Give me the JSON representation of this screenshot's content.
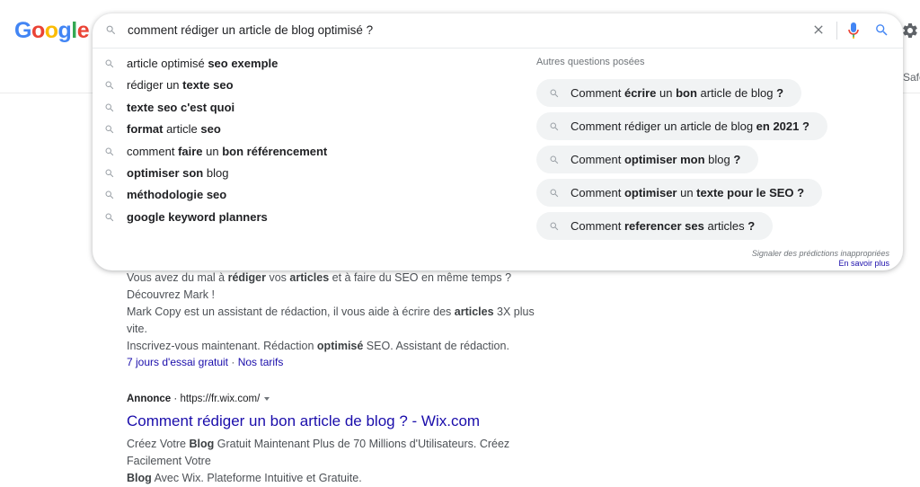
{
  "logo": {
    "letters": [
      {
        "char": "G",
        "color": "#4285F4"
      },
      {
        "char": "o",
        "color": "#EA4335"
      },
      {
        "char": "o",
        "color": "#FBBC05"
      },
      {
        "char": "g",
        "color": "#4285F4"
      },
      {
        "char": "l",
        "color": "#34A853"
      },
      {
        "char": "e",
        "color": "#EA4335"
      }
    ]
  },
  "search": {
    "query": "comment rédiger un article de blog optimisé ?",
    "icons": {
      "search": "search-icon",
      "clear": "close-icon",
      "voice": "mic-icon",
      "submit": "search-icon"
    }
  },
  "suggestions": [
    {
      "parts": [
        {
          "t": "article optimisé ",
          "b": false
        },
        {
          "t": "seo exemple",
          "b": true
        }
      ]
    },
    {
      "parts": [
        {
          "t": "rédiger un ",
          "b": false
        },
        {
          "t": "texte seo",
          "b": true
        }
      ]
    },
    {
      "parts": [
        {
          "t": "texte seo c'est quoi",
          "b": true
        }
      ]
    },
    {
      "parts": [
        {
          "t": "format",
          "b": true
        },
        {
          "t": " article ",
          "b": false
        },
        {
          "t": "seo",
          "b": true
        }
      ]
    },
    {
      "parts": [
        {
          "t": "comment ",
          "b": false
        },
        {
          "t": "faire",
          "b": true
        },
        {
          "t": " un ",
          "b": false
        },
        {
          "t": "bon référencement",
          "b": true
        }
      ]
    },
    {
      "parts": [
        {
          "t": "optimiser son",
          "b": true
        },
        {
          "t": " blog",
          "b": false
        }
      ]
    },
    {
      "parts": [
        {
          "t": "méthodologie seo",
          "b": true
        }
      ]
    },
    {
      "parts": [
        {
          "t": "google keyword planners",
          "b": true
        }
      ]
    }
  ],
  "related_questions": {
    "title": "Autres questions posées",
    "items": [
      {
        "parts": [
          {
            "t": "Comment ",
            "b": false
          },
          {
            "t": "écrire",
            "b": true
          },
          {
            "t": " un ",
            "b": false
          },
          {
            "t": "bon",
            "b": true
          },
          {
            "t": " article de blog ",
            "b": false
          },
          {
            "t": "?",
            "b": true
          }
        ]
      },
      {
        "parts": [
          {
            "t": "Comment rédiger un article de blog ",
            "b": false
          },
          {
            "t": "en 2021 ?",
            "b": true
          }
        ]
      },
      {
        "parts": [
          {
            "t": "Comment ",
            "b": false
          },
          {
            "t": "optimiser mon",
            "b": true
          },
          {
            "t": " blog ",
            "b": false
          },
          {
            "t": "?",
            "b": true
          }
        ]
      },
      {
        "parts": [
          {
            "t": "Comment ",
            "b": false
          },
          {
            "t": "optimiser",
            "b": true
          },
          {
            "t": " un ",
            "b": false
          },
          {
            "t": "texte pour le SEO ?",
            "b": true
          }
        ]
      },
      {
        "parts": [
          {
            "t": "Comment ",
            "b": false
          },
          {
            "t": "referencer ses",
            "b": true
          },
          {
            "t": " articles ",
            "b": false
          },
          {
            "t": "?",
            "b": true
          }
        ]
      }
    ]
  },
  "report_text": "Signaler des prédictions inappropriées",
  "learn_more": "En savoir plus",
  "top_bar": {
    "safe_partial": "Safe"
  },
  "result1": {
    "desc_lines": [
      [
        {
          "t": "Vous avez du mal à ",
          "b": false
        },
        {
          "t": "rédiger",
          "b": true
        },
        {
          "t": " vos ",
          "b": false
        },
        {
          "t": "articles",
          "b": true
        },
        {
          "t": " et à faire du SEO en même temps ? Découvrez Mark !",
          "b": false
        }
      ],
      [
        {
          "t": "Mark Copy est un assistant de rédaction, il vous aide à écrire des ",
          "b": false
        },
        {
          "t": "articles",
          "b": true
        },
        {
          "t": " 3X plus vite.",
          "b": false
        }
      ],
      [
        {
          "t": "Inscrivez-vous maintenant. Rédaction ",
          "b": false
        },
        {
          "t": "optimisé",
          "b": true
        },
        {
          "t": " SEO. Assistant de rédaction.",
          "b": false
        }
      ]
    ],
    "sitelink1": "7 jours d'essai gratuit",
    "sitelink_sep": " · ",
    "sitelink2": "Nos tarifs"
  },
  "result2": {
    "ad_label": "Annonce",
    "ad_sep": " · ",
    "url": "https://fr.wix.com/",
    "title": "Comment rédiger un bon article de blog ? - Wix.com",
    "desc_lines": [
      [
        {
          "t": "Créez Votre ",
          "b": false
        },
        {
          "t": "Blog",
          "b": true
        },
        {
          "t": " Gratuit Maintenant Plus de 70 Millions d'Utilisateurs. Créez Facilement Votre",
          "b": false
        }
      ],
      [
        {
          "t": "Blog",
          "b": true
        },
        {
          "t": " Avec Wix. Plateforme Intuitive et Gratuite.",
          "b": false
        }
      ]
    ]
  }
}
